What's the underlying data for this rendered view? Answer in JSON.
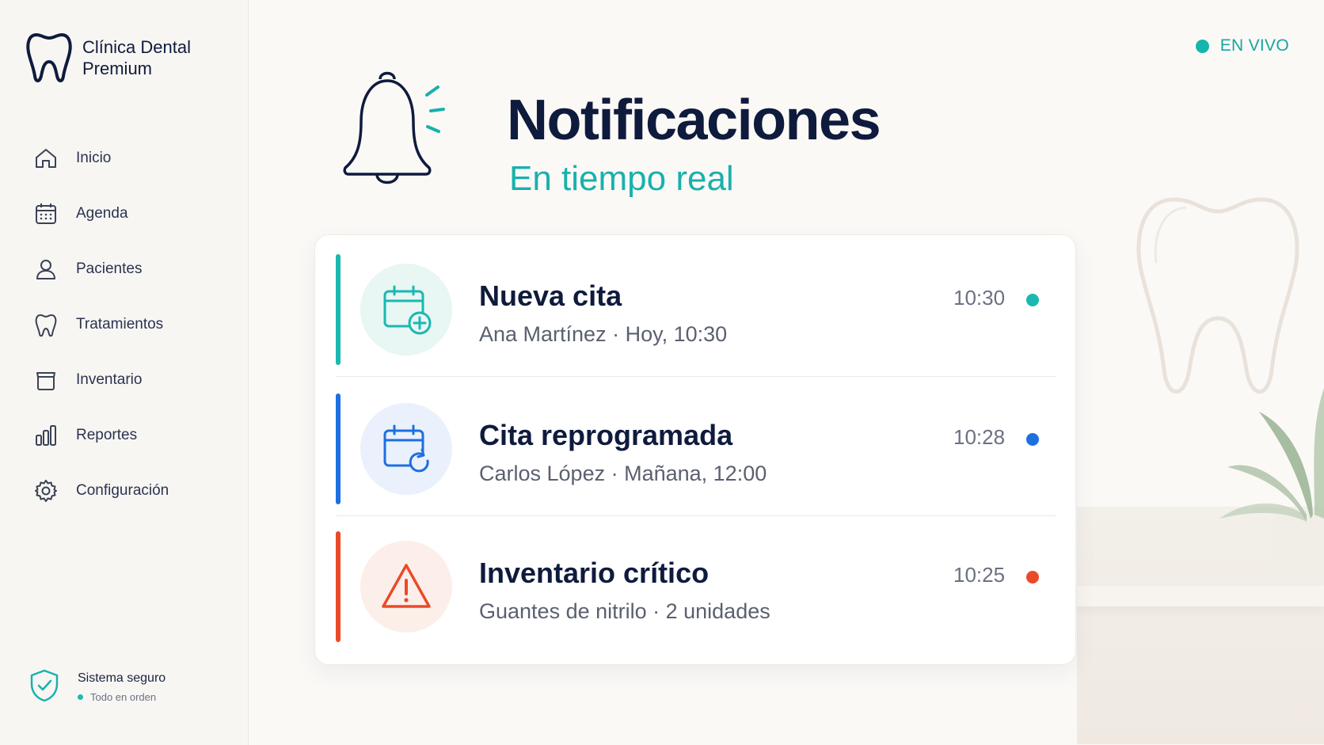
{
  "brand": {
    "line1": "Clínica Dental",
    "line2": "Premium",
    "logo_icon": "tooth-icon"
  },
  "nav": {
    "items": [
      {
        "label": "Inicio",
        "icon": "home-icon"
      },
      {
        "label": "Agenda",
        "icon": "calendar-icon"
      },
      {
        "label": "Pacientes",
        "icon": "user-icon"
      },
      {
        "label": "Tratamientos",
        "icon": "tooth-icon"
      },
      {
        "label": "Inventario",
        "icon": "box-icon"
      },
      {
        "label": "Reportes",
        "icon": "bar-chart-icon"
      },
      {
        "label": "Configuración",
        "icon": "gear-icon"
      }
    ]
  },
  "status": {
    "title": "Sistema seguro",
    "subtitle": "Todo en orden",
    "icon": "shield-check-icon"
  },
  "live": {
    "label": "EN VIVO",
    "color": "#14b5ad"
  },
  "header": {
    "title": "Notificaciones",
    "subtitle": "En tiempo real",
    "icon": "bell-icon"
  },
  "notifications": [
    {
      "title": "Nueva cita",
      "detail": "Ana Martínez · Hoy, 10:30",
      "time": "10:30",
      "color": "#1ab8b0",
      "icon": "calendar-add-icon"
    },
    {
      "title": "Cita reprogramada",
      "detail": "Carlos López · Mañana, 12:00",
      "time": "10:28",
      "color": "#1e6fe0",
      "icon": "calendar-refresh-icon"
    },
    {
      "title": "Inventario crítico",
      "detail": "Guantes de nitrilo · 2 unidades",
      "time": "10:25",
      "color": "#ea4a28",
      "icon": "warning-icon"
    }
  ]
}
